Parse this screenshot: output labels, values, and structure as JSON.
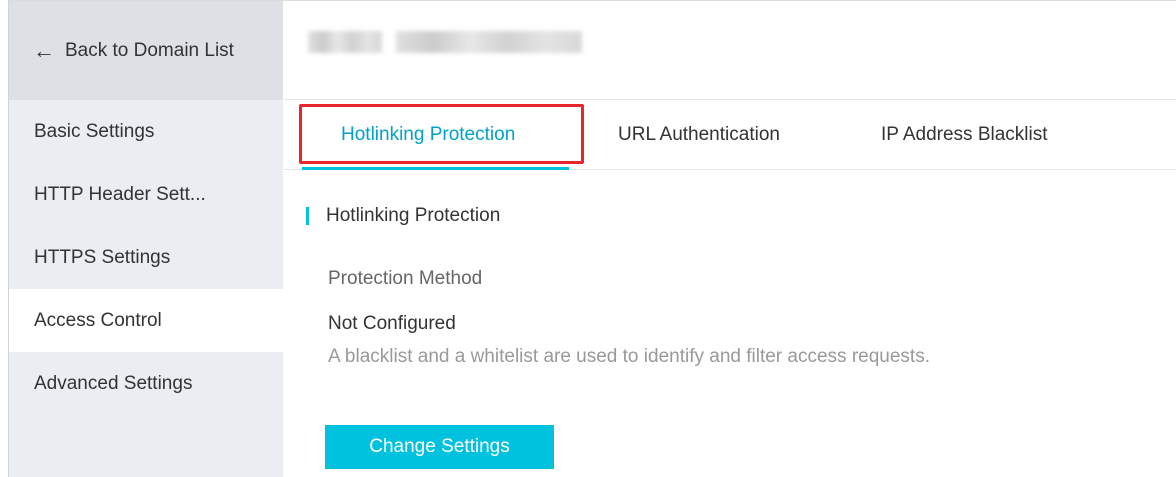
{
  "sidebar": {
    "back_label": "Back to Domain List",
    "back_icon": "arrow-left-icon",
    "items": [
      {
        "label": "Basic Settings"
      },
      {
        "label": "HTTP Header Sett..."
      },
      {
        "label": "HTTPS Settings"
      },
      {
        "label": "Access Control",
        "active": true
      },
      {
        "label": "Advanced Settings"
      }
    ]
  },
  "tabs": [
    {
      "label": "Hotlinking Protection",
      "active": true
    },
    {
      "label": "URL Authentication"
    },
    {
      "label": "IP Address Blacklist"
    }
  ],
  "section": {
    "title": "Hotlinking Protection",
    "field_label": "Protection Method",
    "field_value": "Not Configured",
    "description": "A blacklist and a whitelist are used to identify and filter access requests.",
    "button_label": "Change Settings"
  },
  "colors": {
    "accent": "#00c1de",
    "active_tab_text": "#00a2ca",
    "highlight_border": "#e8262b",
    "sidebar_bg": "#eaedf1"
  }
}
